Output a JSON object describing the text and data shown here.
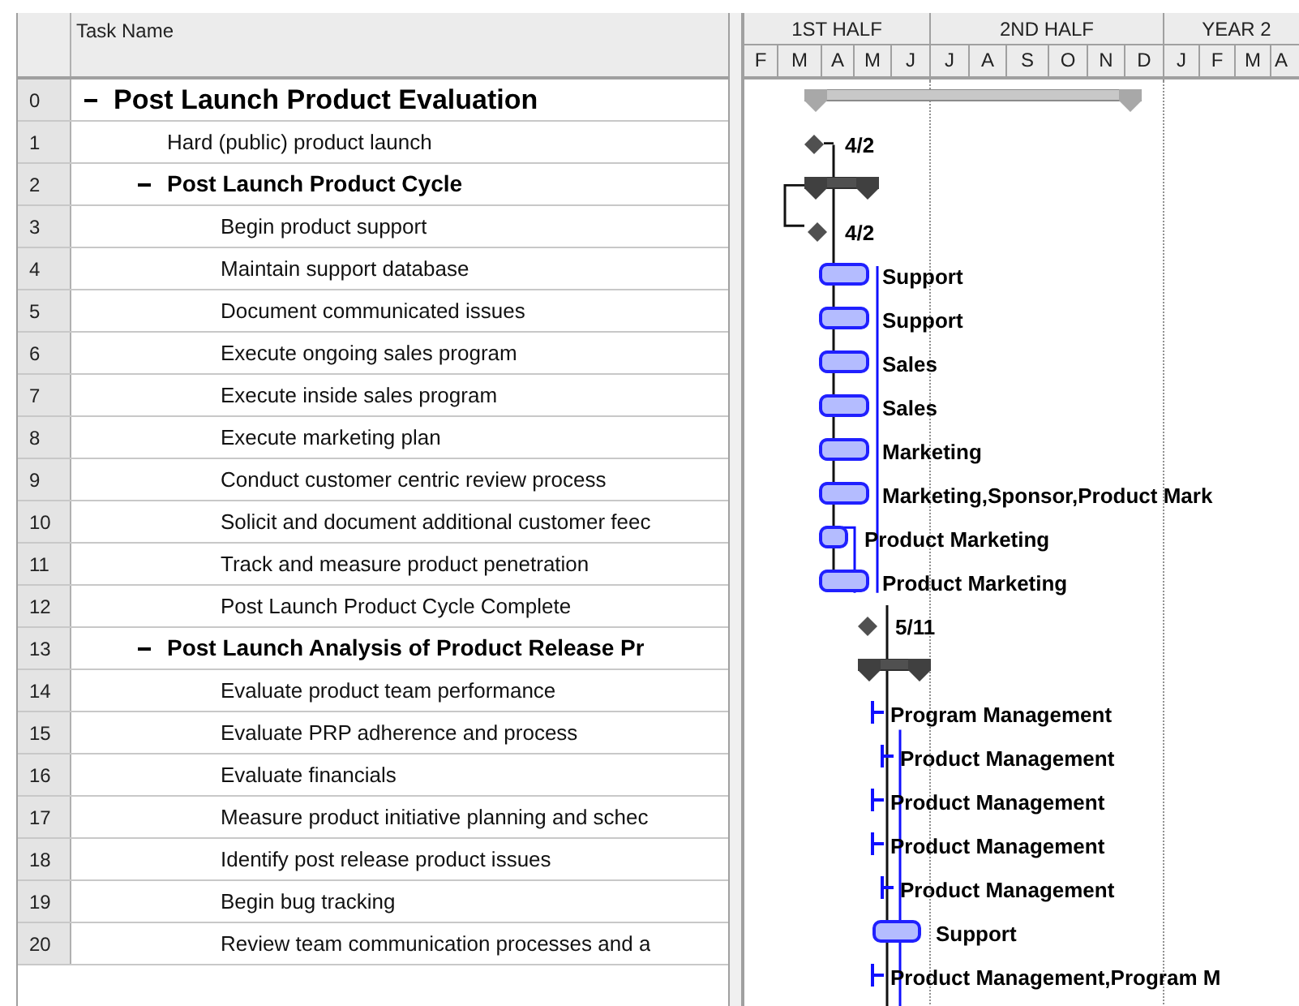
{
  "columns": {
    "name": "Task Name"
  },
  "timescale": {
    "top": [
      "1ST HALF",
      "2ND HALF",
      "YEAR 2"
    ],
    "bottom": [
      "F",
      "M",
      "A",
      "M",
      "J",
      "J",
      "A",
      "S",
      "O",
      "N",
      "D",
      "J",
      "F",
      "M",
      "A"
    ]
  },
  "tasks": [
    {
      "number": "0",
      "name": "Post Launch Product Evaluation",
      "expanded": true,
      "bar": {
        "kind": "summary"
      },
      "children": [
        {
          "number": "1",
          "name": "Hard (public) product launch",
          "bar": {
            "kind": "milestone",
            "label": "4/2"
          }
        },
        {
          "number": "2",
          "name": "Post Launch Product Cycle",
          "expanded": true,
          "bar": {
            "kind": "summary"
          },
          "children": [
            {
              "number": "3",
              "name": "Begin product support",
              "bar": {
                "kind": "milestone",
                "label": "4/2"
              }
            },
            {
              "number": "4",
              "name": "Maintain support database",
              "bar": {
                "kind": "task",
                "label": "Support"
              }
            },
            {
              "number": "5",
              "name": "Document communicated issues",
              "bar": {
                "kind": "task",
                "label": "Support"
              }
            },
            {
              "number": "6",
              "name": "Execute ongoing sales program",
              "bar": {
                "kind": "task",
                "label": "Sales"
              }
            },
            {
              "number": "7",
              "name": "Execute inside sales program",
              "bar": {
                "kind": "task",
                "label": "Sales"
              }
            },
            {
              "number": "8",
              "name": "Execute marketing plan",
              "bar": {
                "kind": "task",
                "label": "Marketing"
              }
            },
            {
              "number": "9",
              "name": "Conduct customer centric review process",
              "bar": {
                "kind": "task",
                "label": "Marketing,Sponsor,Product Mark"
              }
            },
            {
              "number": "10",
              "name": "Solicit and document additional customer feec",
              "bar": {
                "kind": "task",
                "label": "Product Marketing"
              }
            },
            {
              "number": "11",
              "name": "Track and measure product penetration",
              "bar": {
                "kind": "task",
                "label": "Product Marketing"
              }
            },
            {
              "number": "12",
              "name": "Post Launch Product Cycle Complete",
              "bar": {
                "kind": "milestone",
                "label": "5/11"
              }
            }
          ]
        },
        {
          "number": "13",
          "name": "Post Launch Analysis of Product Release Pr",
          "expanded": true,
          "bar": {
            "kind": "summary"
          },
          "children": [
            {
              "number": "14",
              "name": "Evaluate product team performance",
              "bar": {
                "kind": "tick",
                "label": "Program Management"
              }
            },
            {
              "number": "15",
              "name": "Evaluate PRP adherence and process",
              "bar": {
                "kind": "tick",
                "label": "Product Management"
              }
            },
            {
              "number": "16",
              "name": "Evaluate financials",
              "bar": {
                "kind": "tick",
                "label": "Product Management"
              }
            },
            {
              "number": "17",
              "name": "Measure product initiative planning and schec",
              "bar": {
                "kind": "tick",
                "label": "Product Management"
              }
            },
            {
              "number": "18",
              "name": "Identify post release product issues",
              "bar": {
                "kind": "tick",
                "label": "Product Management"
              }
            },
            {
              "number": "19",
              "name": "Begin bug tracking",
              "bar": {
                "kind": "task",
                "label": "Support"
              }
            },
            {
              "number": "20",
              "name": "Review team communication processes and a",
              "bar": {
                "kind": "tick",
                "label": "Product Management,Program M"
              }
            }
          ]
        }
      ]
    }
  ]
}
